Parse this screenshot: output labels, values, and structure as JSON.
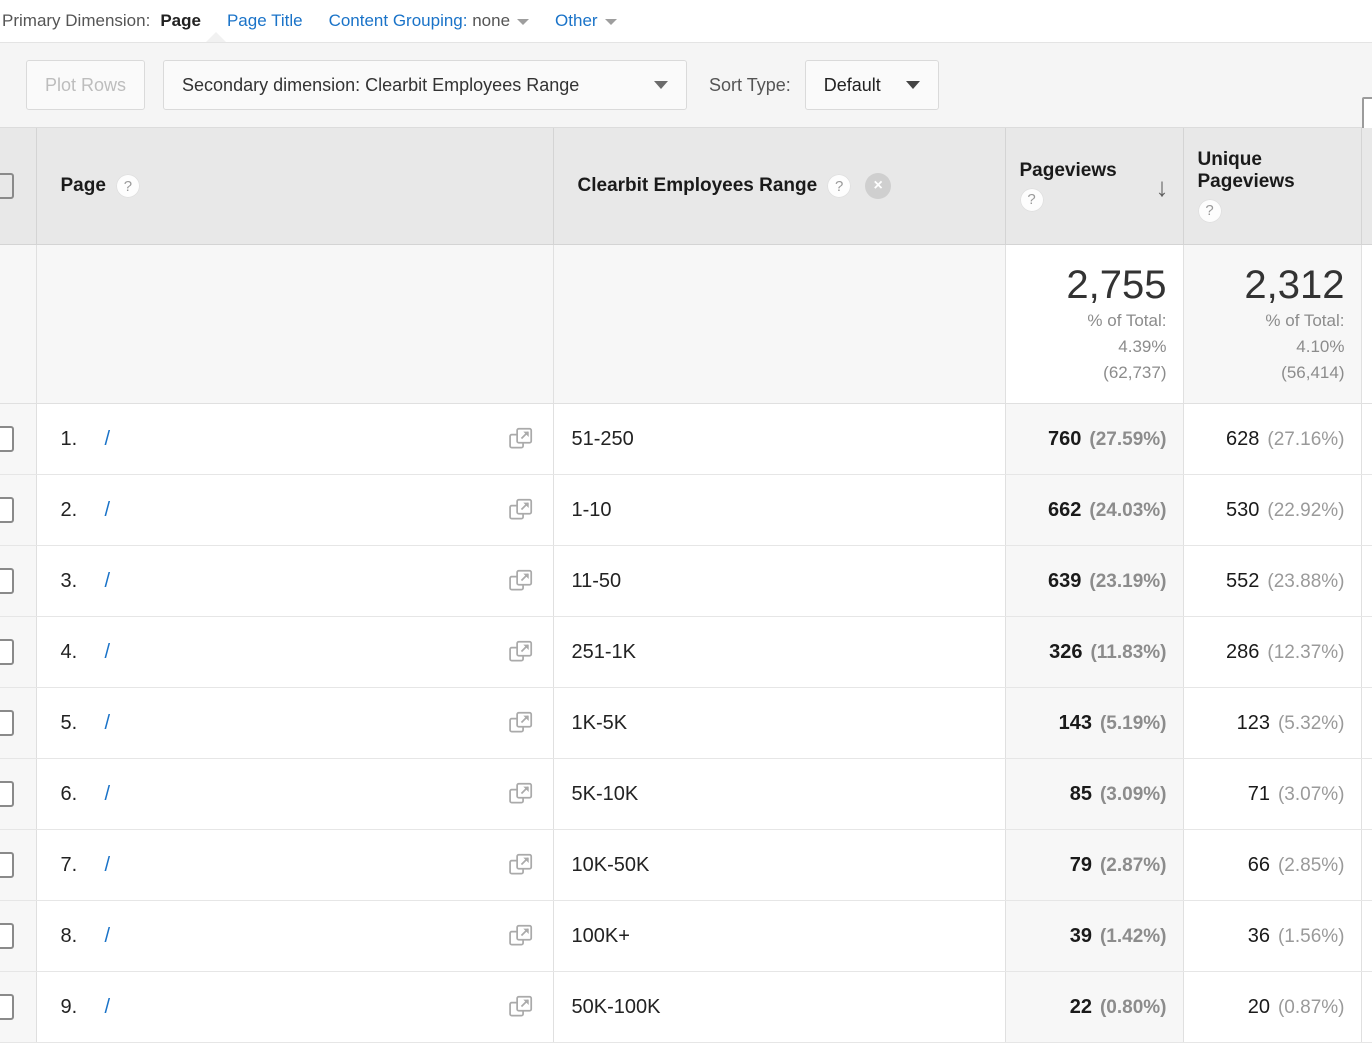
{
  "primary_dimension": {
    "label": "Primary Dimension:",
    "items": [
      {
        "label": "Page",
        "active": true
      },
      {
        "label": "Page Title",
        "active": false
      }
    ],
    "content_grouping": {
      "label": "Content Grouping:",
      "value": "none"
    },
    "other": {
      "label": "Other"
    }
  },
  "toolbar": {
    "plot_rows_label": "Plot Rows",
    "secondary_dimension_label": "Secondary dimension: Clearbit Employees Range",
    "sort_type_label": "Sort Type:",
    "sort_type_value": "Default"
  },
  "table": {
    "columns": {
      "page": {
        "label": "Page",
        "help": "?"
      },
      "secondary": {
        "label": "Clearbit Employees Range",
        "help": "?",
        "remove": "×"
      },
      "pageviews": {
        "label": "Pageviews",
        "help": "?",
        "sort_arrow": "↓"
      },
      "unique_pageviews": {
        "label": "Unique Pageviews",
        "help": "?"
      }
    },
    "totals": {
      "pageviews": {
        "value": "2,755",
        "of_total_label": "% of Total:",
        "percent": "4.39%",
        "basis": "(62,737)"
      },
      "unique_pageviews": {
        "value": "2,312",
        "of_total_label": "% of Total:",
        "percent": "4.10%",
        "basis": "(56,414)"
      }
    },
    "rows": [
      {
        "rank": "1.",
        "page": "/",
        "secondary": "51-250",
        "pageviews": "760",
        "pageviews_pct": "(27.59%)",
        "unique_pageviews": "628",
        "unique_pageviews_pct": "(27.16%)"
      },
      {
        "rank": "2.",
        "page": "/",
        "secondary": "1-10",
        "pageviews": "662",
        "pageviews_pct": "(24.03%)",
        "unique_pageviews": "530",
        "unique_pageviews_pct": "(22.92%)"
      },
      {
        "rank": "3.",
        "page": "/",
        "secondary": "11-50",
        "pageviews": "639",
        "pageviews_pct": "(23.19%)",
        "unique_pageviews": "552",
        "unique_pageviews_pct": "(23.88%)"
      },
      {
        "rank": "4.",
        "page": "/",
        "secondary": "251-1K",
        "pageviews": "326",
        "pageviews_pct": "(11.83%)",
        "unique_pageviews": "286",
        "unique_pageviews_pct": "(12.37%)"
      },
      {
        "rank": "5.",
        "page": "/",
        "secondary": "1K-5K",
        "pageviews": "143",
        "pageviews_pct": "(5.19%)",
        "unique_pageviews": "123",
        "unique_pageviews_pct": "(5.32%)"
      },
      {
        "rank": "6.",
        "page": "/",
        "secondary": "5K-10K",
        "pageviews": "85",
        "pageviews_pct": "(3.09%)",
        "unique_pageviews": "71",
        "unique_pageviews_pct": "(3.07%)"
      },
      {
        "rank": "7.",
        "page": "/",
        "secondary": "10K-50K",
        "pageviews": "79",
        "pageviews_pct": "(2.87%)",
        "unique_pageviews": "66",
        "unique_pageviews_pct": "(2.85%)"
      },
      {
        "rank": "8.",
        "page": "/",
        "secondary": "100K+",
        "pageviews": "39",
        "pageviews_pct": "(1.42%)",
        "unique_pageviews": "36",
        "unique_pageviews_pct": "(1.56%)"
      },
      {
        "rank": "9.",
        "page": "/",
        "secondary": "50K-100K",
        "pageviews": "22",
        "pageviews_pct": "(0.80%)",
        "unique_pageviews": "20",
        "unique_pageviews_pct": "(0.87%)"
      }
    ]
  },
  "colors": {
    "link": "#1a73c8",
    "header_bg": "#e8e8e8",
    "toolbar_bg": "#f5f5f5",
    "metric_tint": "#f7f7f7"
  }
}
